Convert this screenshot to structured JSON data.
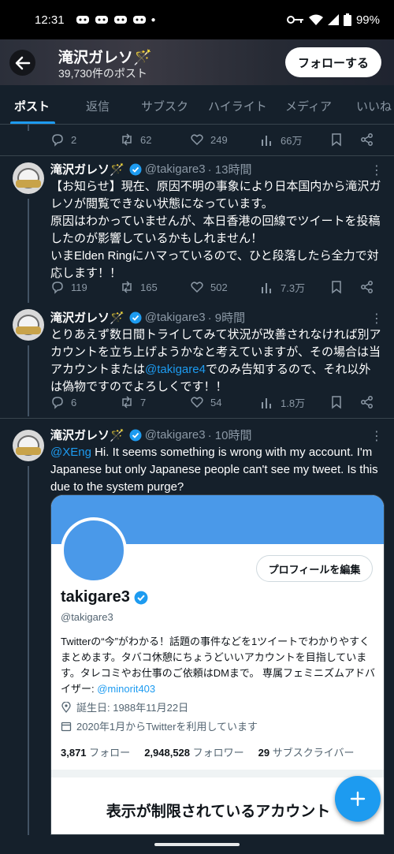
{
  "status_bar": {
    "time": "12:31",
    "battery": "99%"
  },
  "header": {
    "name": "滝沢ガレソ🪄",
    "post_count": "39,730件のポスト",
    "follow_label": "フォローする"
  },
  "tabs": [
    "ポスト",
    "返信",
    "サブスク",
    "ハイライト",
    "メディア",
    "いいね"
  ],
  "tweets": [
    {
      "replies": "2",
      "reposts": "62",
      "likes": "249",
      "views": "66万"
    },
    {
      "name": "滝沢ガレソ🪄",
      "handle": "@takigare3",
      "time": "· 13時間",
      "text": "【お知らせ】現在、原因不明の事象により日本国内から滝沢ガレソが閲覧できない状態になっています。\n原因はわかっていませんが、本日香港の回線でツイートを投稿したのが影響しているかもしれません！\nいまElden Ringにハマっているので、ひと段落したら全力で対応します！！",
      "replies": "119",
      "reposts": "165",
      "likes": "502",
      "views": "7.3万"
    },
    {
      "name": "滝沢ガレソ🪄",
      "handle": "@takigare3",
      "time": "· 9時間",
      "text_before": "とりあえず数日間トライしてみて状況が改善されなければ別アカウントを立ち上げようかなと考えていますが、その場合は当アカウントまたは",
      "mention": "@takigare4",
      "text_after": "でのみ告知するので、それ以外は偽物ですのでよろしくです！！",
      "replies": "6",
      "reposts": "7",
      "likes": "54",
      "views": "1.8万"
    },
    {
      "name": "滝沢ガレソ🪄",
      "handle": "@takigare3",
      "time": "· 10時間",
      "mention": "@XEng",
      "text": " Hi. It seems something is wrong with my account. I'm Japanese but only Japanese people can't see my tweet. Is this due to the system purge?"
    }
  ],
  "card": {
    "edit_label": "プロフィールを編集",
    "name": "takigare3",
    "handle": "@takigare3",
    "bio": "Twitterの“今”がわかる！話題の事件などを1ツイートでわかりやすくまとめます。タバコ休憩にちょうどいいアカウントを目指しています。タレコミやお仕事のご依頼はDMまで。 専属フェミニズムアドバイザー: ",
    "bio_link": "@minorit403",
    "birthday": "誕生日: 1988年11月22日",
    "joined": "2020年1月からTwitterを利用しています",
    "following_count": "3,871",
    "following_label": "フォロー",
    "followers_count": "2,948,528",
    "followers_label": "フォロワー",
    "subscribers_count": "29",
    "subscribers_label": "サブスクライバー",
    "limited_title": "表示が制限されているアカウント"
  },
  "colors": {
    "background": "#15202b",
    "accent": "#1d9bf0",
    "muted": "#8b98a5"
  }
}
